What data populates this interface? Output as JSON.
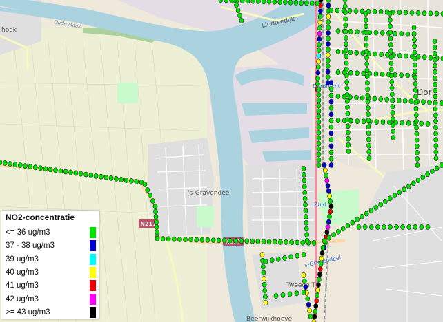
{
  "map": {
    "place_labels": {
      "gravendeel": "'s-Gravendeel",
      "dordrecht": "Dor",
      "lindtsedijk": "Lindtsedijk",
      "tweede": "Tweede T",
      "beerwijkhoeve": "Beerwijkhoeve",
      "oude_maas": "Oude Maas",
      "hoek": "hoek"
    },
    "road_labels": {
      "n217_east": "N217",
      "n217_west": "N217"
    },
    "station_labels": {
      "station_1": "Dordrecht",
      "station_2": "Zuid",
      "station_3": "s-Gravendeel"
    }
  },
  "legend": {
    "title": "NO2-concentratie",
    "items": [
      {
        "label": "<= 36 ug/m3",
        "color": "#00e000"
      },
      {
        "label": "37 - 38 ug/m3",
        "color": "#0000cc"
      },
      {
        "label": "39 ug/m3",
        "color": "#00ffff"
      },
      {
        "label": "40 ug/m3",
        "color": "#ffff00"
      },
      {
        "label": "41 ug/m3",
        "color": "#ee0000"
      },
      {
        "label": "42 ug/m3",
        "color": "#ff00ff"
      },
      {
        "label": ">= 43 ug/m3",
        "color": "#000000"
      }
    ]
  },
  "colors": {
    "water": "#aad3df",
    "land": "#efe9dc",
    "farmland": "#eef0d5",
    "urban": "#e0dfdf",
    "industrial": "#ebdbe8",
    "park": "#c8facc",
    "primary_road": "#fcd6a4",
    "motorway": "#e892a2"
  },
  "measurement_levels": [
    "<= 36 ug/m3",
    "37 - 38 ug/m3",
    "39 ug/m3",
    "40 ug/m3",
    "41 ug/m3",
    "42 ug/m3",
    ">= 43 ug/m3"
  ]
}
